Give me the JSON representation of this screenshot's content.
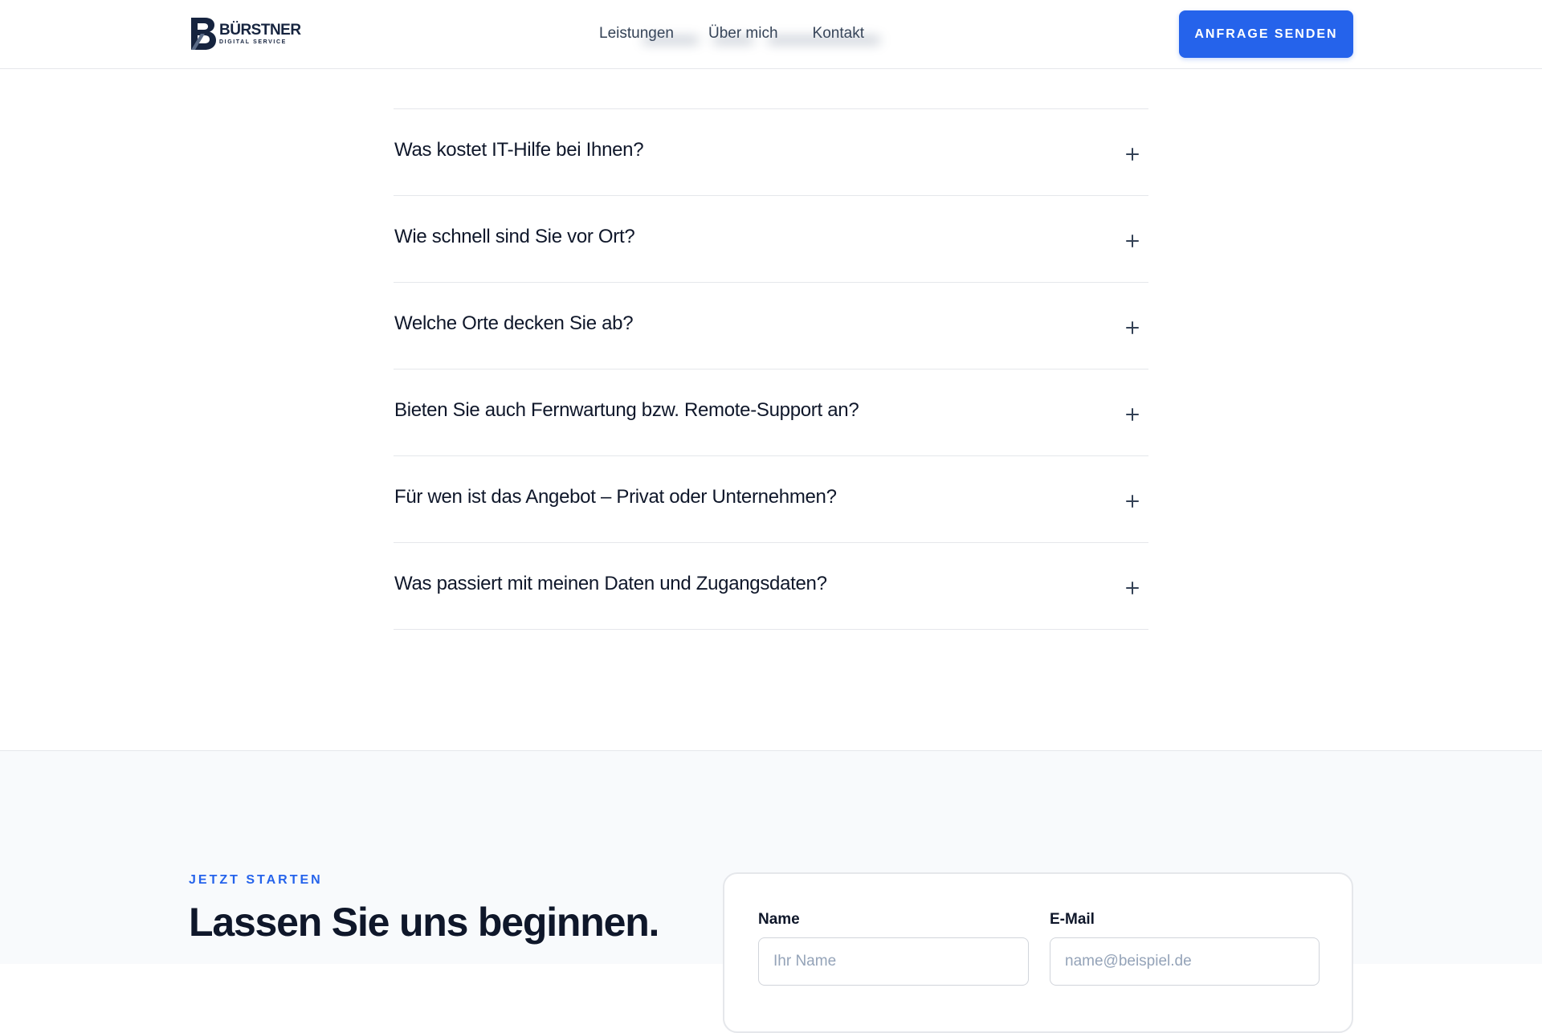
{
  "header": {
    "logo": {
      "name": "BÜRSTNER",
      "subtitle": "DIGITAL SERVICE"
    },
    "nav": [
      {
        "label": "Leistungen"
      },
      {
        "label": "Über mich"
      },
      {
        "label": "Kontakt"
      }
    ],
    "cta_label": "ANFRAGE SENDEN"
  },
  "faq": {
    "items": [
      {
        "question": "Was kostet IT-Hilfe bei Ihnen?"
      },
      {
        "question": "Wie schnell sind Sie vor Ort?"
      },
      {
        "question": "Welche Orte decken Sie ab?"
      },
      {
        "question": "Bieten Sie auch Fernwartung bzw. Remote-Support an?"
      },
      {
        "question": "Für wen ist das Angebot – Privat oder Unternehmen?"
      },
      {
        "question": "Was passiert mit meinen Daten und Zugangsdaten?"
      }
    ]
  },
  "contact": {
    "eyebrow": "JETZT STARTEN",
    "headline": "Lassen Sie uns beginnen.",
    "form": {
      "name_label": "Name",
      "name_placeholder": "Ihr Name",
      "email_label": "E-Mail",
      "email_placeholder": "name@beispiel.de"
    }
  },
  "colors": {
    "accent": "#2563eb",
    "text": "#0f172a",
    "muted": "#334155",
    "border": "#e5e7eb",
    "section_bg": "#f8fafc",
    "logo": "#16243f"
  },
  "icons": {
    "faq_toggle": "plus-icon",
    "logo": "logo-b-icon"
  }
}
